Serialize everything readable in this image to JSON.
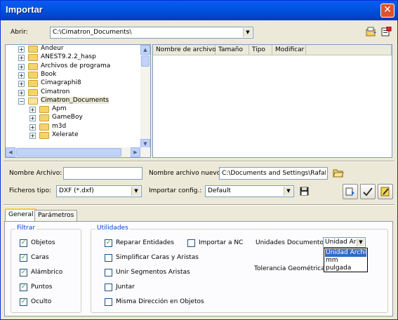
{
  "window": {
    "title": "Importar",
    "close_glyph": "✕"
  },
  "path": {
    "label": "Abrir:",
    "value": "C:\\Cimatron_Documents\\"
  },
  "tree": {
    "items": [
      {
        "label": "Andeur",
        "level": 0,
        "expander": "+"
      },
      {
        "label": "ANEST9.2.2_hasp",
        "level": 0,
        "expander": "+"
      },
      {
        "label": "Archivos de programa",
        "level": 0,
        "expander": "+"
      },
      {
        "label": "Book",
        "level": 0,
        "expander": "+"
      },
      {
        "label": "Cimagraphi8",
        "level": 0,
        "expander": "+"
      },
      {
        "label": "Cimatron",
        "level": 0,
        "expander": "+"
      },
      {
        "label": "Cimatron_Documents",
        "level": 0,
        "expander": "−",
        "selected": true
      },
      {
        "label": "Apm",
        "level": 1,
        "expander": "+"
      },
      {
        "label": "GameBoy",
        "level": 1,
        "expander": "+"
      },
      {
        "label": "m3d",
        "level": 1,
        "expander": "+"
      },
      {
        "label": "Xelerate",
        "level": 1,
        "expander": "+"
      }
    ]
  },
  "files": {
    "columns": [
      "Nombre de archivo",
      "Tamaño",
      "Tipo",
      "Modificar"
    ]
  },
  "form": {
    "filename_label": "Nombre Archivo:",
    "filename_value": "",
    "newname_label": "Nombre archivo nuevo:",
    "newname_value": "C:\\Documents and Settings\\RafaEs\\M",
    "filetype_label": "Ficheros tipo:",
    "filetype_value": "DXF (*.dxf)",
    "config_label": "Importar config.:",
    "config_value": "Default"
  },
  "tabs": [
    {
      "label": "General"
    },
    {
      "label": "Parámetros"
    }
  ],
  "filtrar": {
    "title": "Filtrar",
    "items": [
      {
        "label": "Objetos",
        "checked": true
      },
      {
        "label": "Caras",
        "checked": true
      },
      {
        "label": "Alámbrico",
        "checked": true
      },
      {
        "label": "Puntos",
        "checked": true
      },
      {
        "label": "Oculto",
        "checked": true
      }
    ]
  },
  "utilidades": {
    "title": "Utilidades",
    "reparar": {
      "label": "Reparar Entidades",
      "checked": true
    },
    "importar_nc": {
      "label": "Importar a NC",
      "checked": false
    },
    "simplificar": {
      "label": "Simplificar Caras y Aristas",
      "checked": false
    },
    "unir": {
      "label": "Unir Segmentos Aristas",
      "checked": false
    },
    "juntar": {
      "label": "Juntar",
      "checked": false
    },
    "misma": {
      "label": "Misma Dirección en Objetos",
      "checked": false
    },
    "unidades_label": "Unidades Documento:",
    "unidades_value": "Unidad Arc",
    "unidades_options": [
      "Unidad Archivo",
      "mm",
      "pulgada"
    ],
    "tolerancia_label": "Tolerancia Geométrica:"
  },
  "colors": {
    "title_blue": "#0054e3",
    "close_red": "#e0502d",
    "group_title": "#0046d5",
    "highlight": "#316ac5"
  },
  "icons": [
    "folder-up-icon",
    "new-folder-icon",
    "browse-folder-icon",
    "save-icon",
    "add-config-icon",
    "ok-check-icon",
    "edit-icon",
    "dropdown-arrow-icon"
  ]
}
